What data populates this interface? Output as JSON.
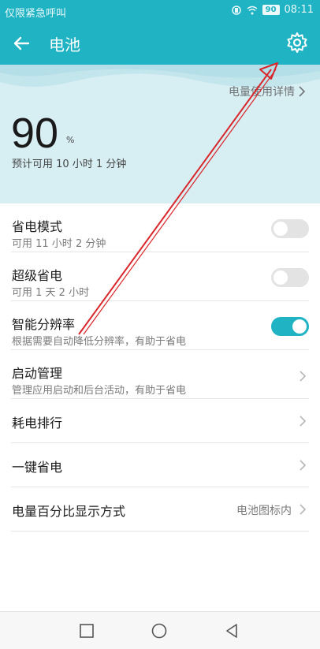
{
  "statusbar": {
    "carrier": "仅限紧急呼叫",
    "battery": "90",
    "time": "08:11"
  },
  "appbar": {
    "title": "电池"
  },
  "hero": {
    "detail_link": "电量使用详情",
    "percent": "90",
    "percent_sign": "%",
    "estimate": "预计可用 10 小时 1 分钟"
  },
  "list": {
    "power_saving": {
      "title": "省电模式",
      "subtitle": "可用 11 小时 2 分钟",
      "on": false
    },
    "ultra_saving": {
      "title": "超级省电",
      "subtitle": "可用 1 天 2 小时",
      "on": false
    },
    "smart_resolution": {
      "title": "智能分辨率",
      "subtitle": "根据需要自动降低分辨率，有助于省电",
      "on": true
    },
    "startup_mgmt": {
      "title": "启动管理",
      "subtitle": "管理应用启动和后台活动，有助于省电"
    },
    "consumption_rank": {
      "title": "耗电排行"
    },
    "one_key_save": {
      "title": "一键省电"
    },
    "percent_display": {
      "title": "电量百分比显示方式",
      "value": "电池图标内"
    }
  },
  "colors": {
    "accent": "#1fb3c3",
    "hero_bg": "#d7eef3",
    "annotation_arrow": "#d9262b"
  },
  "icons": {
    "back": "arrow-left-icon",
    "settings": "gear-icon",
    "chevron": "chevron-right-icon"
  }
}
